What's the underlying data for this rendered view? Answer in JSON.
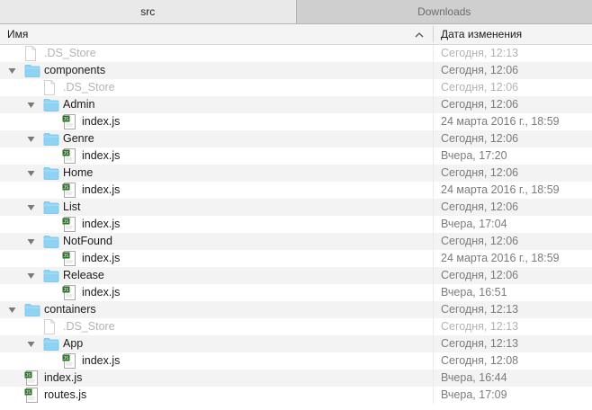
{
  "tabs": [
    {
      "label": "src",
      "active": true
    },
    {
      "label": "Downloads",
      "active": false
    }
  ],
  "columns": {
    "name": "Имя",
    "date": "Дата изменения"
  },
  "colors": {
    "folder": "#8fd3f4",
    "dimmed_text": "#b3b3b3",
    "date_text": "#7b7b7b"
  },
  "rows": [
    {
      "name": ".DS_Store",
      "date": "Сегодня, 12:13",
      "level": 0,
      "type": "file",
      "dim": true
    },
    {
      "name": "components",
      "date": "Сегодня, 12:06",
      "level": 0,
      "type": "folder",
      "expanded": true
    },
    {
      "name": ".DS_Store",
      "date": "Сегодня, 12:06",
      "level": 1,
      "type": "file",
      "dim": true
    },
    {
      "name": "Admin",
      "date": "Сегодня, 12:06",
      "level": 1,
      "type": "folder",
      "expanded": true
    },
    {
      "name": "index.js",
      "date": "24 марта 2016 г., 18:59",
      "level": 2,
      "type": "js"
    },
    {
      "name": "Genre",
      "date": "Сегодня, 12:06",
      "level": 1,
      "type": "folder",
      "expanded": true
    },
    {
      "name": "index.js",
      "date": "Вчера, 17:20",
      "level": 2,
      "type": "js"
    },
    {
      "name": "Home",
      "date": "Сегодня, 12:06",
      "level": 1,
      "type": "folder",
      "expanded": true
    },
    {
      "name": "index.js",
      "date": "24 марта 2016 г., 18:59",
      "level": 2,
      "type": "js"
    },
    {
      "name": "List",
      "date": "Сегодня, 12:06",
      "level": 1,
      "type": "folder",
      "expanded": true
    },
    {
      "name": "index.js",
      "date": "Вчера, 17:04",
      "level": 2,
      "type": "js"
    },
    {
      "name": "NotFound",
      "date": "Сегодня, 12:06",
      "level": 1,
      "type": "folder",
      "expanded": true
    },
    {
      "name": "index.js",
      "date": "24 марта 2016 г., 18:59",
      "level": 2,
      "type": "js"
    },
    {
      "name": "Release",
      "date": "Сегодня, 12:06",
      "level": 1,
      "type": "folder",
      "expanded": true
    },
    {
      "name": "index.js",
      "date": "Вчера, 16:51",
      "level": 2,
      "type": "js"
    },
    {
      "name": "containers",
      "date": "Сегодня, 12:13",
      "level": 0,
      "type": "folder",
      "expanded": true
    },
    {
      "name": ".DS_Store",
      "date": "Сегодня, 12:13",
      "level": 1,
      "type": "file",
      "dim": true
    },
    {
      "name": "App",
      "date": "Сегодня, 12:13",
      "level": 1,
      "type": "folder",
      "expanded": true
    },
    {
      "name": "index.js",
      "date": "Сегодня, 12:08",
      "level": 2,
      "type": "js"
    },
    {
      "name": "index.js",
      "date": "Вчера, 16:44",
      "level": 0,
      "type": "js"
    },
    {
      "name": "routes.js",
      "date": "Вчера, 17:09",
      "level": 0,
      "type": "js"
    }
  ]
}
